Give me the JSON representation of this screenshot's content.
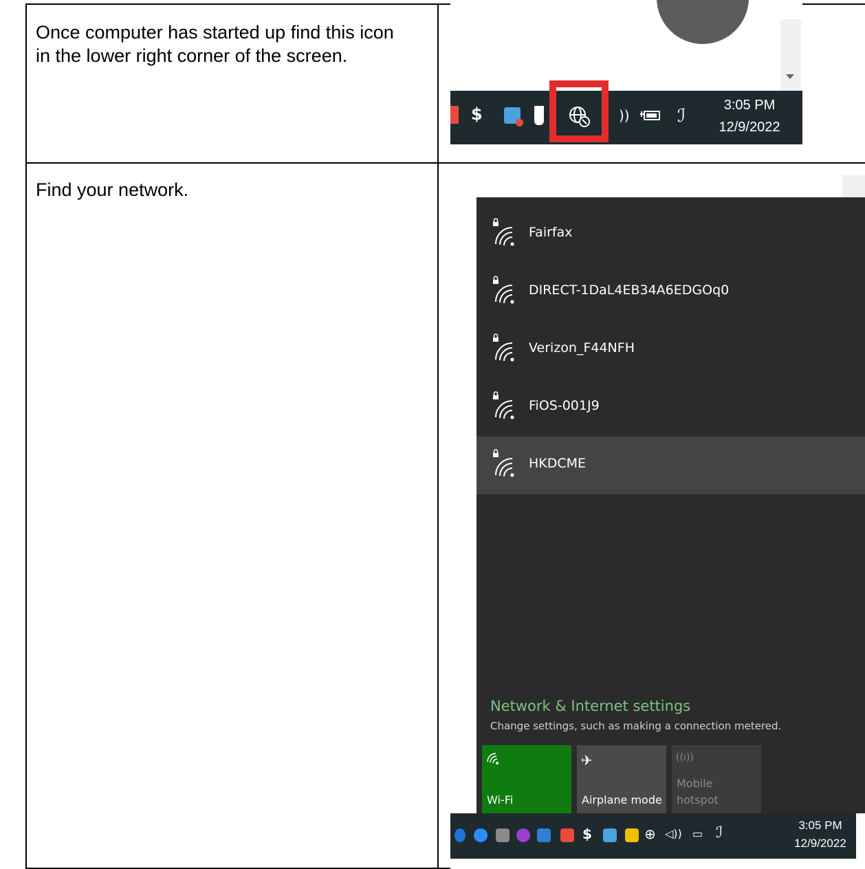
{
  "rows": [
    {
      "instruction": "Once computer has started up find this icon\nin the lower right corner of the screen.",
      "screenshot": {
        "tray_time": "3:05 PM",
        "tray_date": "12/9/2022",
        "highlight_color": "#e32d2d",
        "highlighted_icon": "globe-network-icon"
      }
    },
    {
      "instruction": "Find your network.",
      "screenshot": {
        "networks": [
          {
            "name": "Fairfax",
            "secured": true,
            "selected": false
          },
          {
            "name": "DIRECT-1DaL4EB34A6EDGOq0",
            "secured": true,
            "selected": false
          },
          {
            "name": "Verizon_F44NFH",
            "secured": true,
            "selected": false
          },
          {
            "name": "FiOS-001J9",
            "secured": true,
            "selected": false
          },
          {
            "name": "HKDCME",
            "secured": true,
            "selected": true
          }
        ],
        "settings_link": "Network & Internet settings",
        "settings_desc": "Change settings, such as making a connection metered.",
        "quick_actions": [
          {
            "label": "Wi-Fi",
            "icon": "wifi-icon",
            "state": "on",
            "color": "#107c10"
          },
          {
            "label": "Airplane mode",
            "icon": "airplane-icon",
            "state": "off",
            "color": "#4a4a4a"
          },
          {
            "label": "Mobile\nhotspot",
            "icon": "hotspot-icon",
            "state": "disabled",
            "color": "#3c3c3c"
          }
        ],
        "tray_time": "3:05 PM",
        "tray_date": "12/9/2022"
      }
    }
  ]
}
